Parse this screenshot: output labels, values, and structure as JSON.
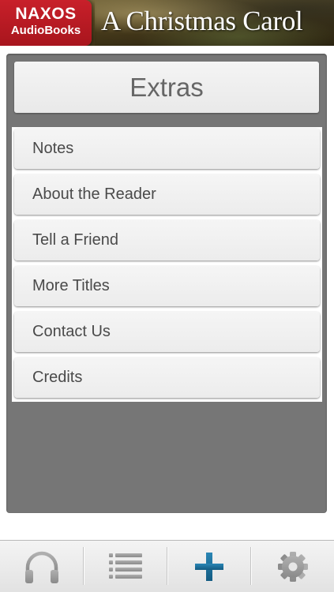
{
  "banner": {
    "logo_line1": "NAXOS",
    "logo_line2": "AudioBooks",
    "book_title": "A Christmas Carol",
    "logo_color": "#b81a23"
  },
  "extras": {
    "title": "Extras"
  },
  "menu": {
    "items": [
      {
        "label": "Notes"
      },
      {
        "label": "About the Reader"
      },
      {
        "label": "Tell a Friend"
      },
      {
        "label": "More Titles"
      },
      {
        "label": "Contact Us"
      },
      {
        "label": "Credits"
      }
    ]
  },
  "tabbar": {
    "tabs": [
      {
        "icon": "headphones-icon",
        "selected": false
      },
      {
        "icon": "list-icon",
        "selected": false
      },
      {
        "icon": "plus-icon",
        "selected": true
      },
      {
        "icon": "gear-icon",
        "selected": false
      }
    ],
    "active_color": "#1d6f9a",
    "inactive_color": "#9a9a9a"
  }
}
